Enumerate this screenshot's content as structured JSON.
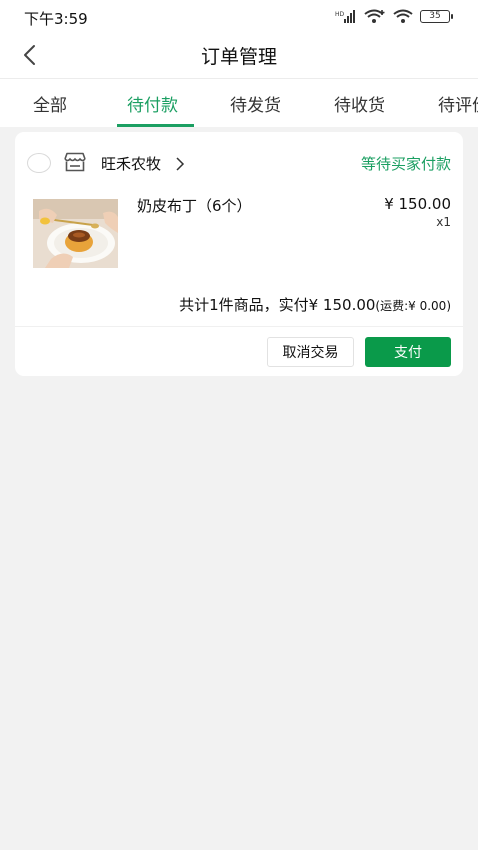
{
  "status_bar": {
    "time": "下午3:59",
    "network_label": "HD",
    "battery": "35"
  },
  "header": {
    "title": "订单管理"
  },
  "tabs": [
    {
      "label": "全部"
    },
    {
      "label": "待付款"
    },
    {
      "label": "待发货"
    },
    {
      "label": "待收货"
    },
    {
      "label": "待评价"
    }
  ],
  "order": {
    "shop_name": "旺禾农牧",
    "status": "等待买家付款",
    "product": {
      "name": "奶皮布丁（6个）",
      "price": "¥ 150.00",
      "quantity": "x1"
    },
    "summary": {
      "text": "共计1件商品，实付¥ 150.00",
      "shipping": "(运费:¥ 0.00)"
    },
    "cancel_label": "取消交易",
    "pay_label": "支付"
  },
  "colors": {
    "accent": "#1b9f62",
    "pay_button": "#0a9a4a",
    "background": "#f2f2f2"
  }
}
